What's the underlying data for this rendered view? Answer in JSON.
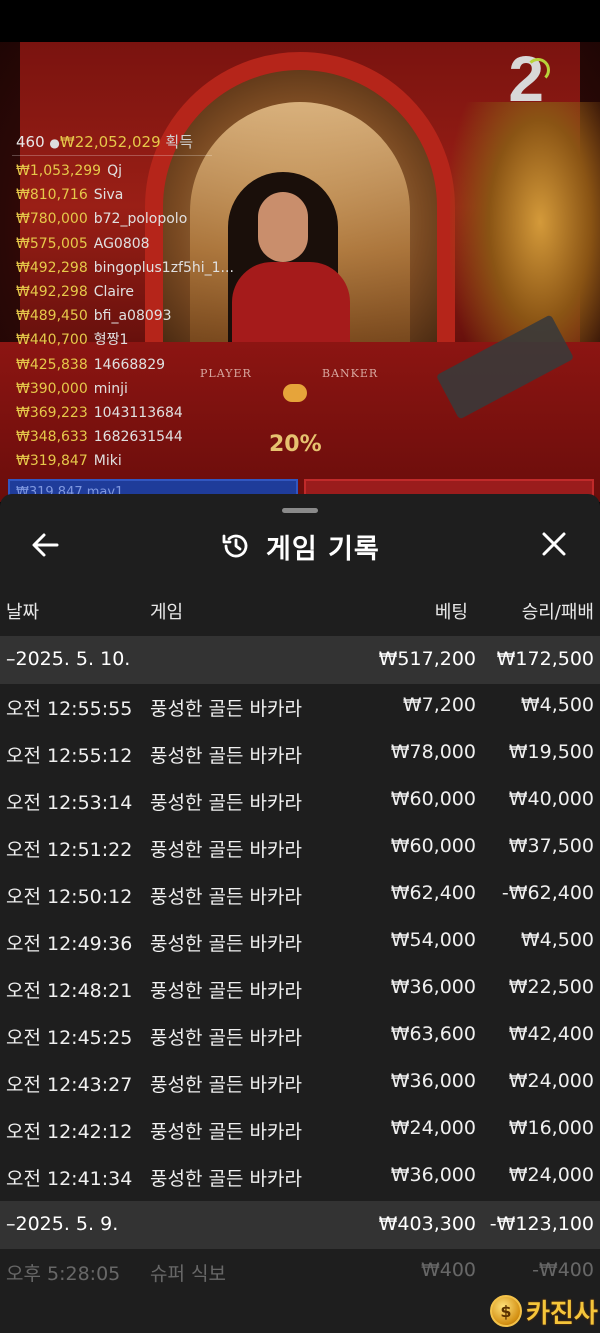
{
  "video": {
    "round_number": "2",
    "total_winners_count": "460",
    "total_winnings": "₩22,052,029",
    "winnings_suffix": "획득",
    "winners": [
      {
        "amount": "₩1,053,299",
        "name": "Qj"
      },
      {
        "amount": "₩810,716",
        "name": "Siva"
      },
      {
        "amount": "₩780,000",
        "name": "b72_polopolo"
      },
      {
        "amount": "₩575,005",
        "name": "AG0808"
      },
      {
        "amount": "₩492,298",
        "name": "bingoplus1zf5hi_1..."
      },
      {
        "amount": "₩492,298",
        "name": "Claire"
      },
      {
        "amount": "₩489,450",
        "name": "bfi_a08093"
      },
      {
        "amount": "₩440,700",
        "name": "형짱1"
      },
      {
        "amount": "₩425,838",
        "name": "14668829"
      },
      {
        "amount": "₩390,000",
        "name": "minji"
      },
      {
        "amount": "₩369,223",
        "name": "1043113684"
      },
      {
        "amount": "₩348,633",
        "name": "1682631544"
      },
      {
        "amount": "₩319,847",
        "name": "Miki"
      }
    ],
    "player_label": "PLAYER",
    "banker_label": "BANKER",
    "percent": "20%",
    "partial_bar_text": "₩319,847  mav1"
  },
  "sheet": {
    "title": "게임 기록",
    "columns": {
      "date": "날짜",
      "game": "게임",
      "bet": "베팅",
      "result": "승리/패배"
    },
    "groups": [
      {
        "date": "–2025. 5. 10.",
        "bet_total": "₩517,200",
        "result_total": "₩172,500",
        "rows": [
          {
            "time": "오전 12:55:55",
            "game": "풍성한 골든 바카라",
            "bet": "₩7,200",
            "result": "₩4,500"
          },
          {
            "time": "오전 12:55:12",
            "game": "풍성한 골든 바카라",
            "bet": "₩78,000",
            "result": "₩19,500"
          },
          {
            "time": "오전 12:53:14",
            "game": "풍성한 골든 바카라",
            "bet": "₩60,000",
            "result": "₩40,000"
          },
          {
            "time": "오전 12:51:22",
            "game": "풍성한 골든 바카라",
            "bet": "₩60,000",
            "result": "₩37,500"
          },
          {
            "time": "오전 12:50:12",
            "game": "풍성한 골든 바카라",
            "bet": "₩62,400",
            "result": "-₩62,400"
          },
          {
            "time": "오전 12:49:36",
            "game": "풍성한 골든 바카라",
            "bet": "₩54,000",
            "result": "₩4,500"
          },
          {
            "time": "오전 12:48:21",
            "game": "풍성한 골든 바카라",
            "bet": "₩36,000",
            "result": "₩22,500"
          },
          {
            "time": "오전 12:45:25",
            "game": "풍성한 골든 바카라",
            "bet": "₩63,600",
            "result": "₩42,400"
          },
          {
            "time": "오전 12:43:27",
            "game": "풍성한 골든 바카라",
            "bet": "₩36,000",
            "result": "₩24,000"
          },
          {
            "time": "오전 12:42:12",
            "game": "풍성한 골든 바카라",
            "bet": "₩24,000",
            "result": "₩16,000"
          },
          {
            "time": "오전 12:41:34",
            "game": "풍성한 골든 바카라",
            "bet": "₩36,000",
            "result": "₩24,000"
          }
        ]
      },
      {
        "date": "–2025. 5. 9.",
        "bet_total": "₩403,300",
        "result_total": "-₩123,100",
        "rows": [
          {
            "time": "오후 5:28:05",
            "game": "슈퍼 식보",
            "bet": "₩400",
            "result": "-₩400"
          }
        ]
      }
    ]
  },
  "watermark": {
    "coin_symbol": "$",
    "text": "카진사"
  },
  "colors": {
    "gold": "#e6c84a",
    "sheet_bg": "#1e1e1e",
    "group_bg": "#333333"
  }
}
